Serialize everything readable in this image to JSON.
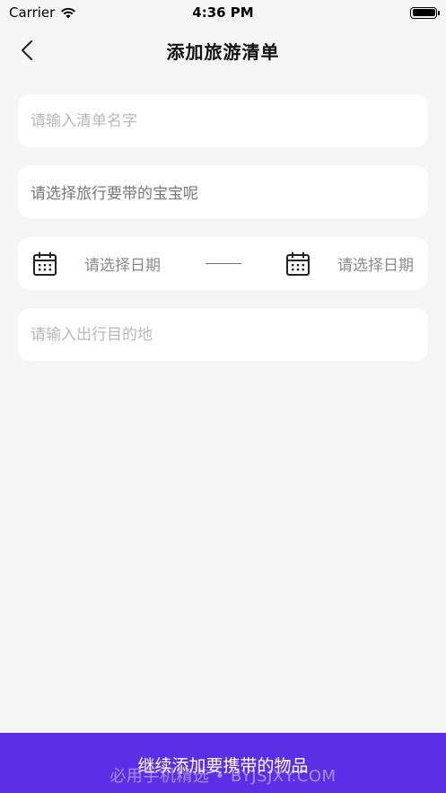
{
  "status_bar": {
    "carrier": "Carrier",
    "time": "4:36 PM"
  },
  "nav": {
    "title": "添加旅游清单"
  },
  "form": {
    "list_name_placeholder": "请输入清单名字",
    "baby_select_label": "请选择旅行要带的宝宝呢",
    "start_date_label": "请选择日期",
    "end_date_label": "请选择日期",
    "destination_placeholder": "请输入出行目的地"
  },
  "footer": {
    "continue_label": "继续添加要携带的物品"
  },
  "watermark": "必用手机精选 • BYJSJXY.COM",
  "colors": {
    "background": "#f5f5f5",
    "card": "#ffffff",
    "accent": "#5b2ee8"
  }
}
